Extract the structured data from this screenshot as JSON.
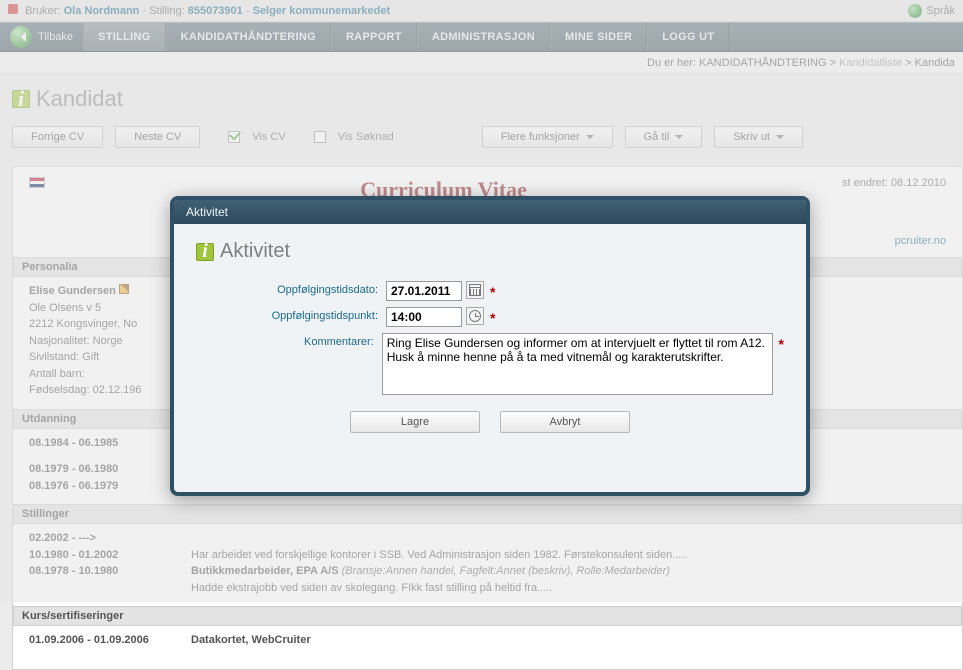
{
  "userbar": {
    "bruker_label": "Bruker:",
    "bruker_name": "Ola Nordmann",
    "stilling_label": "Stilling:",
    "stilling_id": "855073901",
    "stilling_title": "Selger kommunemarkedet",
    "lang_label": "Språk"
  },
  "nav": {
    "back": "Tilbake",
    "items": [
      "STILLING",
      "KANDIDATHÅNDTERING",
      "RAPPORT",
      "ADMINISTRASJON",
      "MINE SIDER",
      "LOGG UT"
    ]
  },
  "breadcrumb": {
    "prefix": "Du er her:",
    "parts": [
      "KANDIDATHÅNDTERING",
      "Kandidatliste",
      "Kandida"
    ]
  },
  "page_title": "Kandidat",
  "toolbar": {
    "prev_cv": "Forrige CV",
    "next_cv": "Neste CV",
    "vis_cv": "Vis CV",
    "vis_soknad": "Vis Søknad",
    "flere": "Flere funksjoner",
    "ga_til": "Gå til",
    "skriv_ut": "Skriv ut"
  },
  "cv": {
    "heading": "Curriculum Vitae",
    "last_modified_label": "st endret:",
    "last_modified_date": "08.12.2010",
    "domain_fragment": "pcruiter.no",
    "sections": {
      "personalia": "Personalia",
      "utdanning": "Utdanning",
      "stillinger": "Stillinger",
      "kurs": "Kurs/sertifiseringer"
    },
    "person": {
      "name": "Elise Gundersen",
      "addr1": "Ole Olsens v 5",
      "addr2": "2212 Kongsvinger, No",
      "nasj": "Nasjonalitet: Norge",
      "sivil": "Sivilstand: Gift",
      "barn": "Antall barn:",
      "fdag": "Fødselsdag: 02.12.196"
    },
    "utdanning_rows": [
      "08.1984 - 06.1985",
      "08.1979 - 06.1980",
      "08.1976 - 06.1979"
    ],
    "stillinger_rows": [
      {
        "dates": "02.2002 - --->",
        "text": ""
      },
      {
        "dates": "10.1980 - 01.2002",
        "text": "Har arbeidet ved forskjellige kontorer i SSB. Ved Administrasjon siden 1982. Førstekonsulent siden....."
      },
      {
        "dates": "08.1978 - 10.1980",
        "bold": "Butikkmedarbeider, EPA A/S",
        "italic": " (Bransje:Annen handel, Fagfelt:Annet (beskriv), Rolle:Medarbeider)",
        "text2": "Hadde ekstrajobb ved siden av skolegang. FIkk fast stilling på heltid fra....."
      }
    ],
    "kurs_rows": [
      {
        "dates": "01.09.2006 - 01.09.2006",
        "text": "Datakortet, WebCruiter"
      }
    ]
  },
  "dialog": {
    "title": "Aktivitet",
    "heading": "Aktivitet",
    "fields": {
      "dato_label": "Oppfølgingstidsdato:",
      "dato_value": "27.01.2011",
      "tid_label": "Oppfølgingstidspunkt:",
      "tid_value": "14:00",
      "kommentar_label": "Kommentarer:",
      "kommentar_value": "Ring Elise Gundersen og informer om at intervjuelt er flyttet til rom A12. Husk å minne henne på å ta med vitnemål og karakterutskrifter."
    },
    "buttons": {
      "save": "Lagre",
      "cancel": "Avbryt"
    }
  }
}
